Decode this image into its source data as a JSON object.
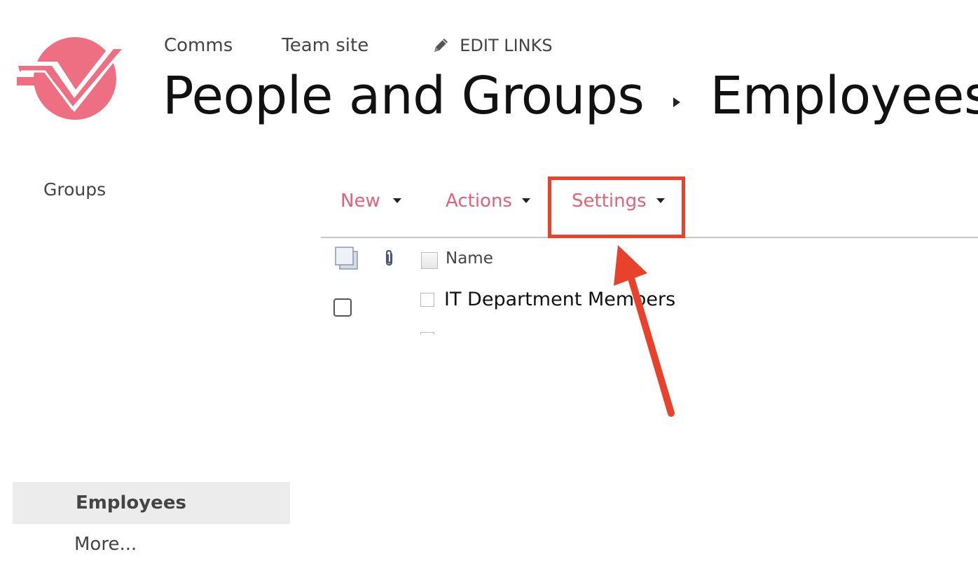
{
  "site_nav": {
    "links": [
      "Comms",
      "Team site"
    ],
    "edit_links_label": "EDIT LINKS"
  },
  "page_title": {
    "parent": "People and Groups",
    "current": "Employees"
  },
  "sidebar": {
    "groups_label": "Groups",
    "selected_item": "Employees",
    "more_label": "More..."
  },
  "command_bar": {
    "new_label": "New",
    "actions_label": "Actions",
    "settings_label": "Settings"
  },
  "list": {
    "column_headers": [
      "Name"
    ],
    "rows": [
      {
        "name": "IT Department Members"
      }
    ]
  },
  "colors": {
    "brand": "#e0637a",
    "logo": "#ee6f82",
    "annotation": "#e8412c"
  },
  "icons": {
    "logo": "site-logo-icon",
    "edit": "pencil-icon",
    "breadcrumb_separator": "triangle-right-icon",
    "dropdown": "caret-down-icon",
    "select_all": "multi-select-icon",
    "attachment": "paperclip-icon",
    "annotation": "arrow-icon"
  }
}
